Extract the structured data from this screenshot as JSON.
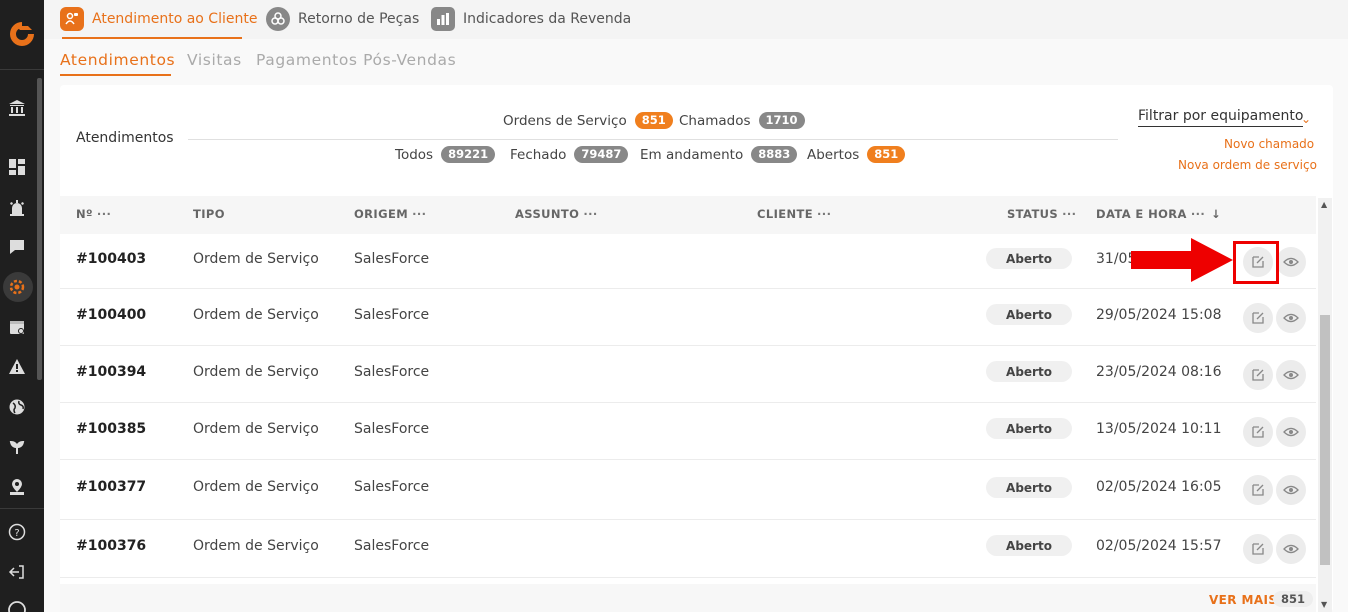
{
  "top_tabs": [
    {
      "label": "Atendimento ao Cliente"
    },
    {
      "label": "Retorno de Peças"
    },
    {
      "label": "Indicadores da Revenda"
    }
  ],
  "sub_tabs": [
    {
      "label": "Atendimentos"
    },
    {
      "label": "Visitas"
    },
    {
      "label": "Pagamentos Pós-Vendas"
    }
  ],
  "card": {
    "title": "Atendimentos",
    "stats_top": [
      {
        "label": "Ordens de Serviço",
        "count": "851"
      },
      {
        "label": "Chamados",
        "count": "1710"
      }
    ],
    "stats_bottom": [
      {
        "label": "Todos",
        "count": "89221"
      },
      {
        "label": "Fechado",
        "count": "79487"
      },
      {
        "label": "Em andamento",
        "count": "8883"
      },
      {
        "label": "Abertos",
        "count": "851"
      }
    ],
    "filter_label": "Filtrar por equipamento",
    "new_call": "Novo chamado",
    "new_order": "Nova ordem de serviço"
  },
  "table": {
    "headers": {
      "num": "Nº",
      "tipo": "TIPO",
      "origem": "ORIGEM",
      "assunto": "ASSUNTO",
      "cliente": "CLIENTE",
      "status": "STATUS",
      "data": "DATA E HORA",
      "dots": "···"
    },
    "rows": [
      {
        "num": "#100403",
        "tipo": "Ordem de Serviço",
        "origem": "SalesForce",
        "status": "Aberto",
        "data": "31/05"
      },
      {
        "num": "#100400",
        "tipo": "Ordem de Serviço",
        "origem": "SalesForce",
        "status": "Aberto",
        "data": "29/05/2024 15:08"
      },
      {
        "num": "#100394",
        "tipo": "Ordem de Serviço",
        "origem": "SalesForce",
        "status": "Aberto",
        "data": "23/05/2024 08:16"
      },
      {
        "num": "#100385",
        "tipo": "Ordem de Serviço",
        "origem": "SalesForce",
        "status": "Aberto",
        "data": "13/05/2024 10:11"
      },
      {
        "num": "#100377",
        "tipo": "Ordem de Serviço",
        "origem": "SalesForce",
        "status": "Aberto",
        "data": "02/05/2024 16:05"
      },
      {
        "num": "#100376",
        "tipo": "Ordem de Serviço",
        "origem": "SalesForce",
        "status": "Aberto",
        "data": "02/05/2024 15:57"
      }
    ]
  },
  "footer": {
    "ver_mais": "VER MAIS",
    "count": "851"
  },
  "icons": {
    "sidebar": [
      "logo-icon",
      "bank-icon",
      "dashboard-icon",
      "alarm-icon",
      "chat-icon",
      "service-gear-icon",
      "calendar-icon",
      "warning-icon",
      "globe-icon",
      "plant-icon",
      "map-pin-icon",
      "help-icon",
      "logout-icon",
      "avatar-icon"
    ],
    "row_actions": [
      "edit-icon",
      "eye-icon"
    ]
  },
  "colors": {
    "accent": "#e8711a",
    "sidebar": "#1f1f1f",
    "highlight": "#e00000"
  }
}
